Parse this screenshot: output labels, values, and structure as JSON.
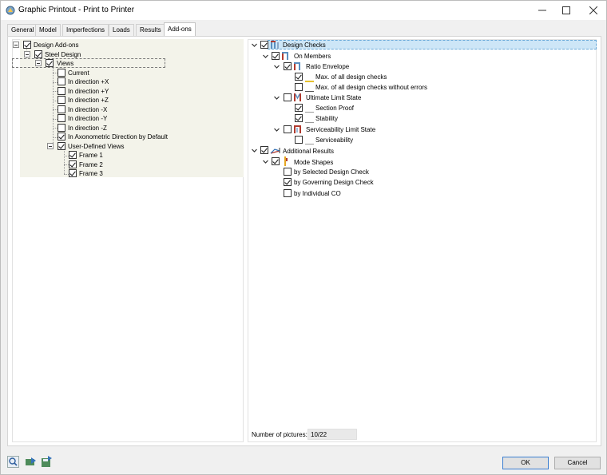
{
  "window": {
    "title": "Graphic Printout - Print to Printer"
  },
  "tabs": [
    {
      "label": "General"
    },
    {
      "label": "Model"
    },
    {
      "label": "Imperfections"
    },
    {
      "label": "Loads"
    },
    {
      "label": "Results"
    },
    {
      "label": "Add-ons",
      "active": true
    }
  ],
  "left_tree": {
    "root": {
      "label": "Design Add-ons",
      "checked": true
    },
    "steel": {
      "label": "Steel Design",
      "checked": true
    },
    "views": {
      "label": "Views",
      "checked": true
    },
    "view_items": [
      {
        "label": "Current",
        "checked": false
      },
      {
        "label": "In direction +X",
        "checked": false
      },
      {
        "label": "In direction +Y",
        "checked": false
      },
      {
        "label": "In direction +Z",
        "checked": false
      },
      {
        "label": "In direction -X",
        "checked": false
      },
      {
        "label": "In direction -Y",
        "checked": false
      },
      {
        "label": "In direction -Z",
        "checked": false
      },
      {
        "label": "In Axonometric Direction by Default",
        "checked": true
      }
    ],
    "user_views": {
      "label": "User-Defined Views",
      "checked": true
    },
    "frames": [
      {
        "label": "Frame 1",
        "checked": true
      },
      {
        "label": "Frame 2",
        "checked": true
      },
      {
        "label": "Frame 3",
        "checked": true
      }
    ]
  },
  "right_tree": {
    "design_checks": {
      "label": "Design Checks",
      "checked": true
    },
    "on_members": {
      "label": "On Members",
      "checked": true
    },
    "ratio_envelope": {
      "label": "Ratio Envelope",
      "checked": true
    },
    "max_all": {
      "label": "Max. of all design checks",
      "checked": true
    },
    "max_no_errors": {
      "label": "Max. of all design checks without errors",
      "checked": false
    },
    "uls": {
      "label": "Ultimate Limit State",
      "checked": false
    },
    "section_proof": {
      "label": "Section Proof",
      "checked": true
    },
    "stability": {
      "label": "Stability",
      "checked": true
    },
    "sls": {
      "label": "Serviceability Limit State",
      "checked": false
    },
    "serviceability": {
      "label": "Serviceability",
      "checked": false
    },
    "additional_results": {
      "label": "Additional Results",
      "checked": true
    },
    "mode_shapes": {
      "label": "Mode Shapes",
      "checked": true
    },
    "by_selected": {
      "label": "by Selected Design Check",
      "checked": false
    },
    "by_governing": {
      "label": "by Governing Design Check",
      "checked": true
    },
    "by_individual": {
      "label": "by Individual CO",
      "checked": false
    }
  },
  "footer": {
    "pictures_label": "Number of pictures:",
    "pictures_value": "10/22",
    "ok_label": "OK",
    "cancel_label": "Cancel"
  },
  "colors": {
    "highlight_bg": "#cde6f7",
    "tree_bg": "#f3f3ea",
    "ok_border": "#3c7fd1"
  }
}
